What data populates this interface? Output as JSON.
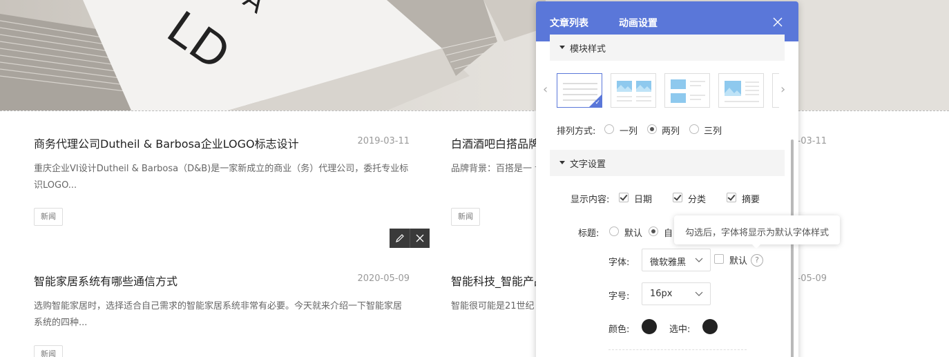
{
  "colors": {
    "accent": "#5a77d9",
    "panel_header": "#5a77d9",
    "swatch": "#222222"
  },
  "articles": [
    {
      "title": "商务代理公司Dutheil & Barbosa企业LOGO标志设计",
      "date": "2019-03-11",
      "summary": "重庆企业VI设计Dutheil & Barbosa（D&B)是一家新成立的商业（务）代理公司，委托专业标识LOGO...",
      "tag": "新闻"
    },
    {
      "title": "白酒酒吧白搭品牌",
      "date": "2019-03-11",
      "summary": "品牌背景：百搭是一                                        认为是老年人口的白酒，白",
      "tag": "新闻"
    },
    {
      "title": "智能家居系统有哪些通信方式",
      "date": "2020-05-09",
      "summary": "选购智能家居时，选择适合自己需求的智能家居系统非常有必要。今天就来介绍一下智能家居系统的四种...",
      "tag": "新闻"
    },
    {
      "title": "智能科技_智能产品",
      "date": "2020-05-09",
      "summary": "智能很可能是21世纪                                        处于研发的投入阶段，就像",
      "tag": "新闻"
    }
  ],
  "panel": {
    "tabs": [
      "文章列表",
      "动画设置"
    ],
    "section_module": "模块样式",
    "arrange_label": "排列方式:",
    "arrange_options": [
      "一列",
      "两列",
      "三列"
    ],
    "section_text": "文字设置",
    "display_label": "显示内容:",
    "display_options": [
      "日期",
      "分类",
      "摘要"
    ],
    "title_label": "标题:",
    "title_options": [
      "默认",
      "自"
    ],
    "font_label": "字体:",
    "font_value": "微软雅黑",
    "font_default_label": "默认",
    "size_label": "字号:",
    "size_value": "16px",
    "color_label": "颜色:",
    "selected_label": "选中:",
    "tooltip": "勾选后，字体将显示为默认字体样式"
  }
}
